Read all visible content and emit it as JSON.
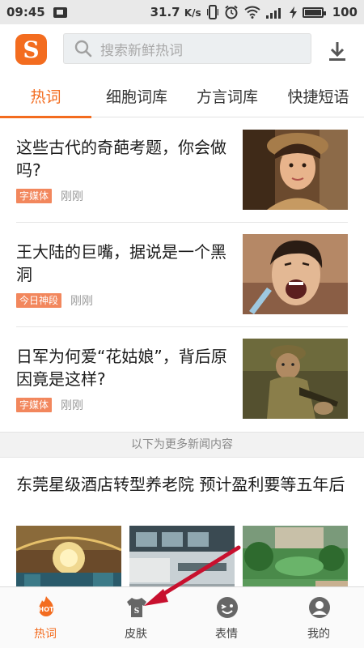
{
  "status_bar": {
    "time": "09:45",
    "speed": "31.7",
    "speed_unit": "K/s",
    "battery": "100"
  },
  "header": {
    "logo_letter": "S",
    "search_placeholder": "搜索新鲜热词"
  },
  "tabs": [
    {
      "label": "热词",
      "active": true
    },
    {
      "label": "细胞词库",
      "active": false
    },
    {
      "label": "方言词库",
      "active": false
    },
    {
      "label": "快捷短语",
      "active": false
    }
  ],
  "news": [
    {
      "title": "这些古代的奇葩考题，你会做吗?",
      "tag": "字媒体",
      "time": "刚刚"
    },
    {
      "title": "王大陆的巨嘴，据说是一个黑洞",
      "tag": "今日神段",
      "time": "刚刚"
    },
    {
      "title": "日军为何爱“花姑娘”，背后原因竟是这样?",
      "tag": "字媒体",
      "time": "刚刚"
    }
  ],
  "more_label": "以下为更多新闻内容",
  "feature": {
    "title": "东莞星级酒店转型养老院 预计盈利要等五年后"
  },
  "bottom_nav": [
    {
      "label": "热词",
      "icon": "hot-icon",
      "active": true
    },
    {
      "label": "皮肤",
      "icon": "skin-shirt-icon",
      "active": false
    },
    {
      "label": "表情",
      "icon": "emoji-face-icon",
      "active": false
    },
    {
      "label": "我的",
      "icon": "profile-icon",
      "active": false
    }
  ],
  "hot_badge": "HOT",
  "skin_badge": "S",
  "colors": {
    "accent": "#f36c1f",
    "tag_bg": "#f2875d",
    "arrow": "#c8102e"
  }
}
